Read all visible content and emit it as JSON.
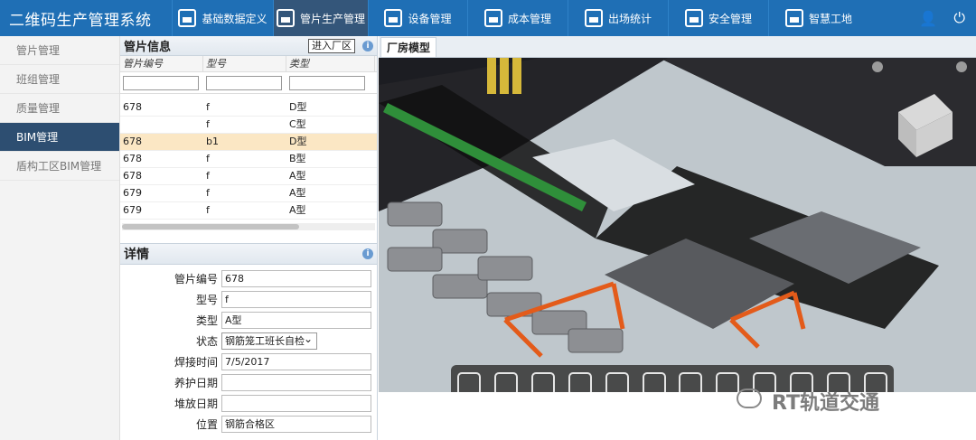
{
  "app": {
    "title": "二维码生产管理系统"
  },
  "topnav": [
    {
      "label": "基础数据定义",
      "active": false,
      "icon": "bar-chart-icon"
    },
    {
      "label": "管片生产管理",
      "active": true,
      "icon": "users-gear-icon"
    },
    {
      "label": "设备管理",
      "active": false,
      "icon": "person-icon"
    },
    {
      "label": "成本管理",
      "active": false,
      "icon": "truck-icon"
    },
    {
      "label": "出场统计",
      "active": false,
      "icon": "truck-icon"
    },
    {
      "label": "安全管理",
      "active": false,
      "icon": "truck-icon"
    },
    {
      "label": "智慧工地",
      "active": false,
      "icon": "truck-icon"
    }
  ],
  "sidebar": [
    {
      "label": "管片管理",
      "active": false
    },
    {
      "label": "班组管理",
      "active": false
    },
    {
      "label": "质量管理",
      "active": false
    },
    {
      "label": "BIM管理",
      "active": true
    },
    {
      "label": "盾构工区BIM管理",
      "active": false
    }
  ],
  "segments_panel": {
    "title": "管片信息",
    "enter_button": "进入厂区",
    "columns": [
      "管片编号",
      "型号",
      "类型"
    ],
    "rows": [
      {
        "code": "678",
        "model": "f",
        "type": "D型",
        "selected": false
      },
      {
        "code": "",
        "model": "f",
        "type": "C型",
        "selected": false
      },
      {
        "code": "678",
        "model": "b1",
        "type": "D型",
        "selected": true
      },
      {
        "code": "678",
        "model": "f",
        "type": "B型",
        "selected": false
      },
      {
        "code": "678",
        "model": "f",
        "type": "A型",
        "selected": false
      },
      {
        "code": "679",
        "model": "f",
        "type": "A型",
        "selected": false
      },
      {
        "code": "679",
        "model": "f",
        "type": "A型",
        "selected": false
      }
    ]
  },
  "detail": {
    "title": "详情",
    "fields": [
      {
        "label": "管片编号",
        "value": "678"
      },
      {
        "label": "型号",
        "value": "f"
      },
      {
        "label": "类型",
        "value": "A型"
      },
      {
        "label": "状态",
        "value": "钢筋笼工班长自检"
      },
      {
        "label": "焊接时间",
        "value": "7/5/2017"
      },
      {
        "label": "养护日期",
        "value": ""
      },
      {
        "label": "堆放日期",
        "value": ""
      },
      {
        "label": "位置",
        "value": "钢筋合格区"
      }
    ]
  },
  "view": {
    "tab": "厂房模型",
    "watermark": "RT轨道交通"
  }
}
